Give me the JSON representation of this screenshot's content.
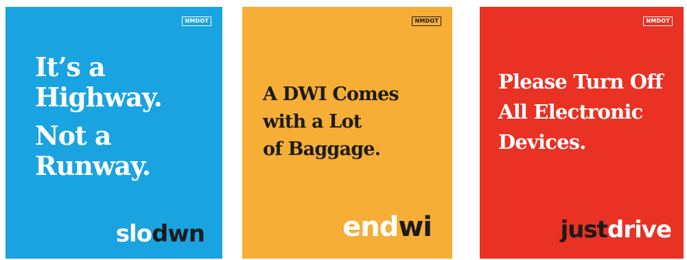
{
  "posters": [
    {
      "background": "#1aa3e1",
      "badge": "NMDOT",
      "headline": [
        "It’s a",
        "Highway.",
        "Not a",
        "Runway."
      ],
      "logo": {
        "part1": "slo",
        "part2": "dwn"
      }
    },
    {
      "background": "#f6ae36",
      "badge": "NMDOT",
      "headline": [
        "A DWI Comes",
        "with a Lot",
        "of Baggage."
      ],
      "logo": {
        "part1": "end",
        "part2": "wi"
      }
    },
    {
      "background": "#e93124",
      "badge": "NMDOT",
      "headline": [
        "Please Turn Off",
        "All Electronic",
        "Devices."
      ],
      "logo": {
        "part1": "just",
        "part2": "drive"
      }
    }
  ]
}
